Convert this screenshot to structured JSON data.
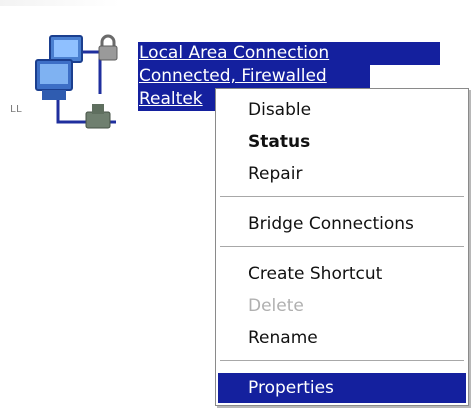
{
  "connection": {
    "name": "Local Area Connection",
    "status": "Connected, Firewalled",
    "device": "Realtek"
  },
  "side_mark": "LL",
  "context_menu": {
    "items": [
      {
        "label": "Disable"
      },
      {
        "label": "Status"
      },
      {
        "label": "Repair"
      },
      {
        "label": "Bridge Connections"
      },
      {
        "label": "Create Shortcut"
      },
      {
        "label": "Delete"
      },
      {
        "label": "Rename"
      },
      {
        "label": "Properties"
      }
    ]
  },
  "icons": {
    "connection_icon": "network-connection-icon",
    "lock_icon": "firewall-lock-icon"
  },
  "colors": {
    "selection": "#14209e",
    "disabled_text": "#b0b0b0"
  }
}
